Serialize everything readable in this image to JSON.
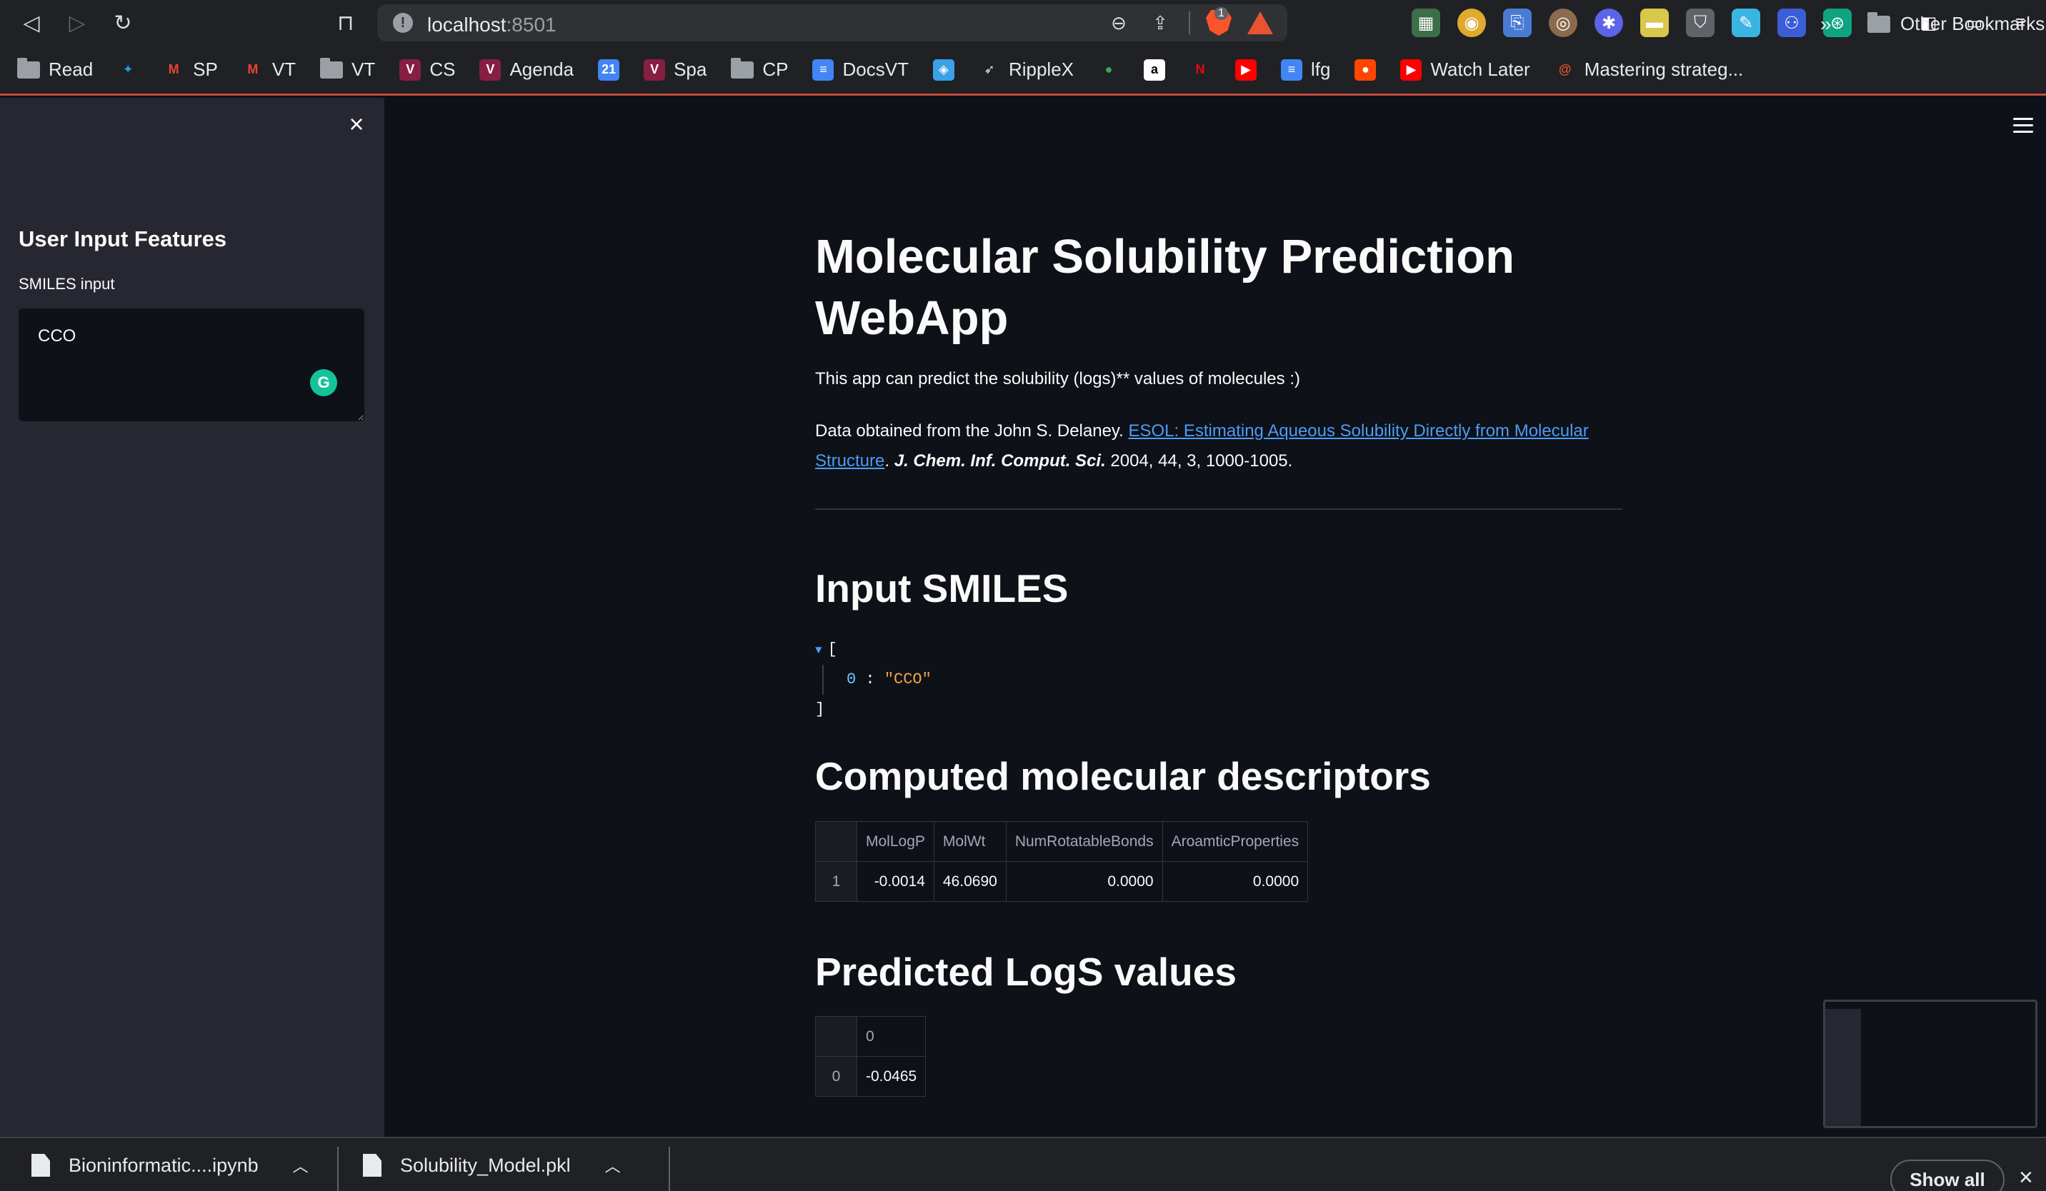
{
  "browser": {
    "url_host": "localhost",
    "url_port": ":8501",
    "shield_badge": "1"
  },
  "bookmarks": [
    {
      "label": "Read",
      "icon": "folder-icon"
    },
    {
      "label": "",
      "icon": "twitter-icon"
    },
    {
      "label": "SP",
      "icon": "gmail-icon"
    },
    {
      "label": "VT",
      "icon": "gmail-icon"
    },
    {
      "label": "VT",
      "icon": "folder-icon"
    },
    {
      "label": "CS",
      "icon": "vt-icon"
    },
    {
      "label": "Agenda",
      "icon": "vt-icon"
    },
    {
      "label": "",
      "icon": "calendar-icon"
    },
    {
      "label": "Spa",
      "icon": "vt-icon"
    },
    {
      "label": "CP",
      "icon": "folder-icon"
    },
    {
      "label": "DocsVT",
      "icon": "docs-icon"
    },
    {
      "label": "",
      "icon": "extension-icon"
    },
    {
      "label": "RippleX",
      "icon": "rocket-icon"
    },
    {
      "label": "",
      "icon": "maps-icon"
    },
    {
      "label": "",
      "icon": "amazon-icon"
    },
    {
      "label": "",
      "icon": "netflix-icon"
    },
    {
      "label": "",
      "icon": "youtube-icon"
    },
    {
      "label": "lfg",
      "icon": "docs-icon"
    },
    {
      "label": "",
      "icon": "reddit-icon"
    },
    {
      "label": "Watch Later",
      "icon": "youtube-icon"
    },
    {
      "label": "Mastering strateg...",
      "icon": "spiral-icon"
    }
  ],
  "bookmarks_more": "»",
  "bookmarks_other": "Other Bookmarks",
  "sidebar": {
    "title": "User Input Features",
    "input_label": "SMILES input",
    "input_value": "CCO",
    "grammarly": "G"
  },
  "main": {
    "title": "Molecular Solubility Prediction WebApp",
    "description": "This app can predict the solubility (logs)** values of molecules :)",
    "ref_prefix": "Data obtained from the John S. Delaney. ",
    "ref_link": "ESOL:  Estimating Aqueous Solubility Directly from Molecular Structure",
    "ref_sep": ". ",
    "ref_journal": "J. Chem. Inf. Comput. Sci.",
    "ref_suffix": " 2004, 44, 3, 1000-1005.",
    "input_heading": "Input SMILES",
    "json_open": "[",
    "json_index": "0",
    "json_colon": " : ",
    "json_value": "\"CCO\"",
    "json_close": "]",
    "descriptors_heading": "Computed molecular descriptors",
    "descriptors_table": {
      "columns": [
        "MolLogP",
        "MolWt",
        "NumRotatableBonds",
        "AroamticProperties"
      ],
      "rows": [
        {
          "index": "1",
          "values": [
            "-0.0014",
            "46.0690",
            "0.0000",
            "0.0000"
          ]
        }
      ]
    },
    "predicted_heading": "Predicted LogS values",
    "predicted_table": {
      "columns": [
        "0"
      ],
      "rows": [
        {
          "index": "0",
          "values": [
            "-0.0465"
          ]
        }
      ]
    }
  },
  "downloads": {
    "file1": "Bioninformatic....ipynb",
    "file2": "Solubility_Model.pkl",
    "show_all": "Show all"
  }
}
